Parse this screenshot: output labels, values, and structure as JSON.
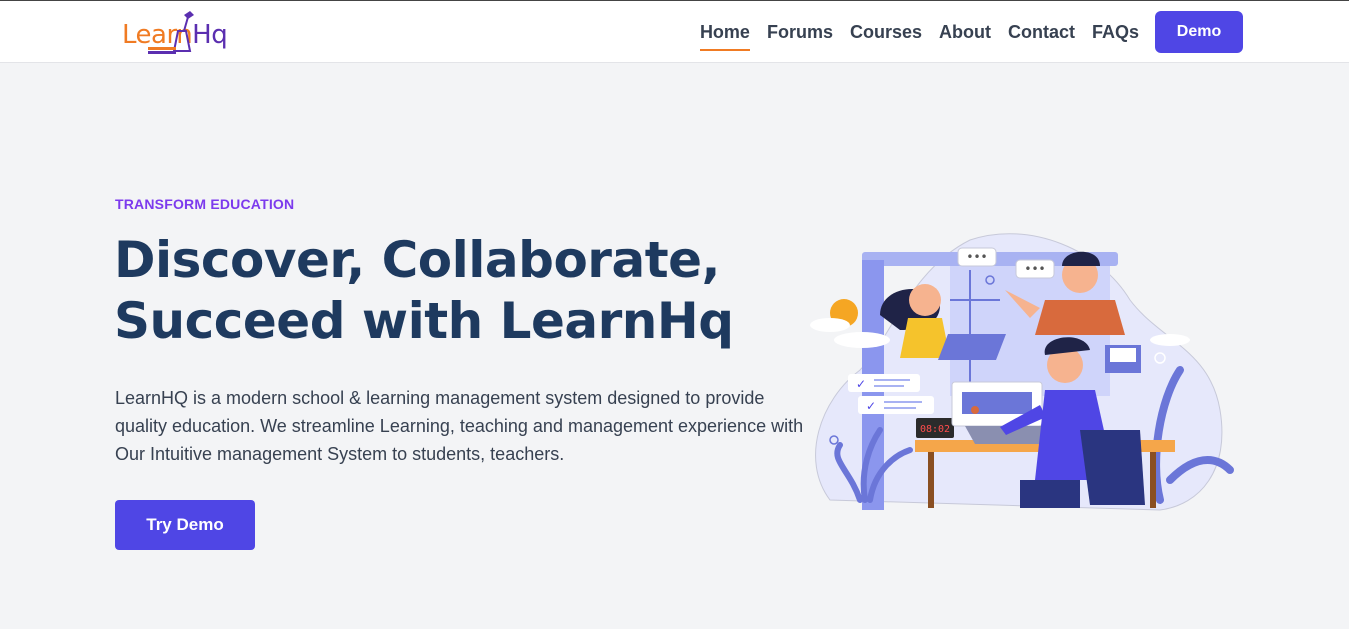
{
  "header": {
    "logo": {
      "part1": "Learn",
      "part2": "Hq"
    },
    "nav": [
      {
        "label": "Home",
        "active": true
      },
      {
        "label": "Forums",
        "active": false
      },
      {
        "label": "Courses",
        "active": false
      },
      {
        "label": "About",
        "active": false
      },
      {
        "label": "Contact",
        "active": false
      },
      {
        "label": "FAQs",
        "active": false
      }
    ],
    "demo_label": "Demo"
  },
  "hero": {
    "eyebrow": "TRANSFORM EDUCATION",
    "title_line1": "Discover, Collaborate,",
    "title_line2": "Succeed with LearnHq",
    "description": "LearnHQ is a modern school & learning management system designed to provide quality education. We streamline Learning, teaching and management experience with Our Intuitive management System to students, teachers.",
    "cta_label": "Try Demo",
    "clock_text": "08:02"
  },
  "colors": {
    "accent": "#4f46e5",
    "eyebrow": "#7c3aed",
    "heading": "#1e3a5f",
    "logo_orange": "#f07b23",
    "logo_purple": "#5b2fb0"
  }
}
